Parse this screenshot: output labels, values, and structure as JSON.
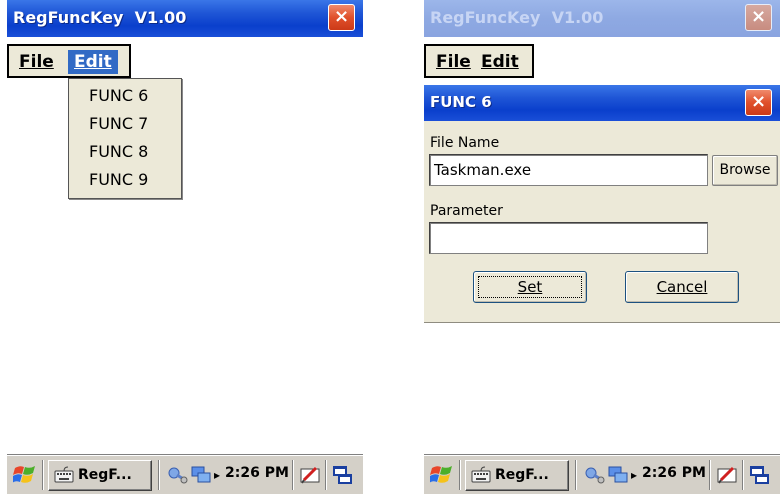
{
  "left_window": {
    "title": "RegFuncKey  V1.00",
    "close_label": "×",
    "menu": {
      "file_label": "File",
      "edit_label": "Edit"
    },
    "edit_dropdown": [
      {
        "label": "FUNC 6"
      },
      {
        "label": "FUNC 7"
      },
      {
        "label": "FUNC 8"
      },
      {
        "label": "FUNC 9"
      }
    ]
  },
  "right_window": {
    "title": "RegFuncKey  V1.00",
    "close_label": "×",
    "menu": {
      "file_label": "File",
      "edit_label": "Edit"
    },
    "dialog": {
      "title": "FUNC 6",
      "close_label": "×",
      "file_name_label": "File Name",
      "file_name_value": "Taskman.exe",
      "browse_label": "Browse",
      "parameter_label": "Parameter",
      "parameter_value": "",
      "set_label": "Set",
      "cancel_label": "Cancel"
    }
  },
  "taskbar": {
    "task_label": "RegF...",
    "clock": "2:26 PM",
    "icons": [
      "windows-start-icon",
      "keyboard-icon",
      "network-icon",
      "connectivity-icon",
      "tray-expand-arrow",
      "input-panel-icon",
      "task-switch-icon"
    ],
    "arrow_glyph": "▸"
  },
  "colors": {
    "titlebar_active": "#0a3fcc",
    "titlebar_inactive": "#8aa4e0",
    "menu_highlight": "#316ac5",
    "close_button": "#e0502b",
    "dialog_face": "#ece9d8",
    "taskbar": "#d4d0c8"
  }
}
